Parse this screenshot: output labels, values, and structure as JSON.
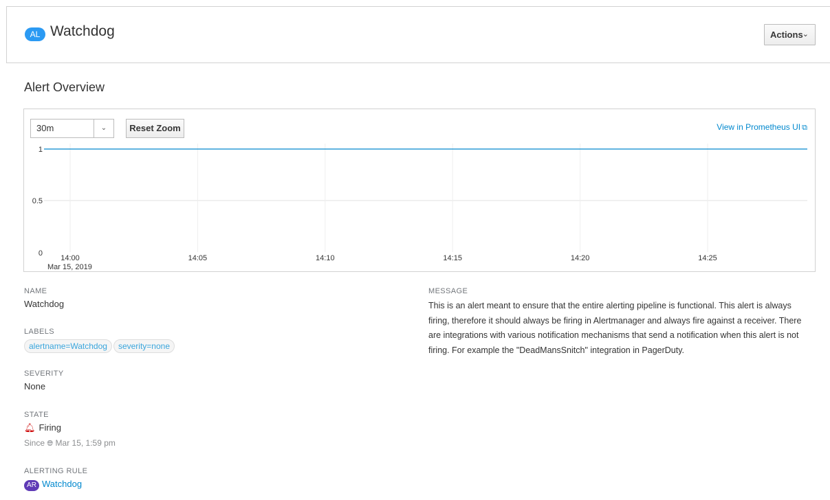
{
  "header": {
    "badge": "AL",
    "title": "Watchdog",
    "actions_label": "Actions",
    "actions_icon": "chevron-down-icon"
  },
  "overview": {
    "title": "Alert Overview",
    "time_range": "30m",
    "reset_zoom": "Reset Zoom",
    "prometheus_link": "View in Prometheus UI",
    "prometheus_icon": "external-link-icon"
  },
  "chart_data": {
    "type": "line",
    "title": "",
    "xlabel": "",
    "ylabel": "",
    "x_ticks": [
      "14:00",
      "14:05",
      "14:10",
      "14:15",
      "14:20",
      "14:25"
    ],
    "x_tick_sublabel": "Mar 15, 2019",
    "y_ticks": [
      "0",
      "0.5",
      "1"
    ],
    "ylim": [
      0,
      1
    ],
    "xlim_minutes": [
      0,
      29
    ],
    "grid": true,
    "series": [
      {
        "x": [
          0,
          29
        ],
        "values": [
          1,
          1
        ],
        "color": "#0088ce"
      }
    ]
  },
  "details": {
    "name_label": "Name",
    "name_value": "Watchdog",
    "labels_label": "Labels",
    "labels": [
      "alertname=Watchdog",
      "severity=none"
    ],
    "severity_label": "Severity",
    "severity_value": "None",
    "state_label": "State",
    "state_value": "Firing",
    "state_icon": "bell-icon",
    "since_prefix": "Since",
    "since_icon": "globe-icon",
    "since_value": "Mar 15, 1:59 pm",
    "rule_label": "Alerting Rule",
    "rule_badge": "AR",
    "rule_value": "Watchdog"
  },
  "message": {
    "label": "Message",
    "text": "This is an alert meant to ensure that the entire alerting pipeline is functional. This alert is always firing, therefore it should always be firing in Alertmanager and always fire against a receiver. There are integrations with various notification mechanisms that send a notification when this alert is not firing. For example the \"DeadMansSnitch\" integration in PagerDuty."
  },
  "colors": {
    "accent": "#0088ce",
    "alert_badge": "#2b9af3",
    "rule_badge": "#5f3ab6",
    "firing": "#cc0000"
  }
}
